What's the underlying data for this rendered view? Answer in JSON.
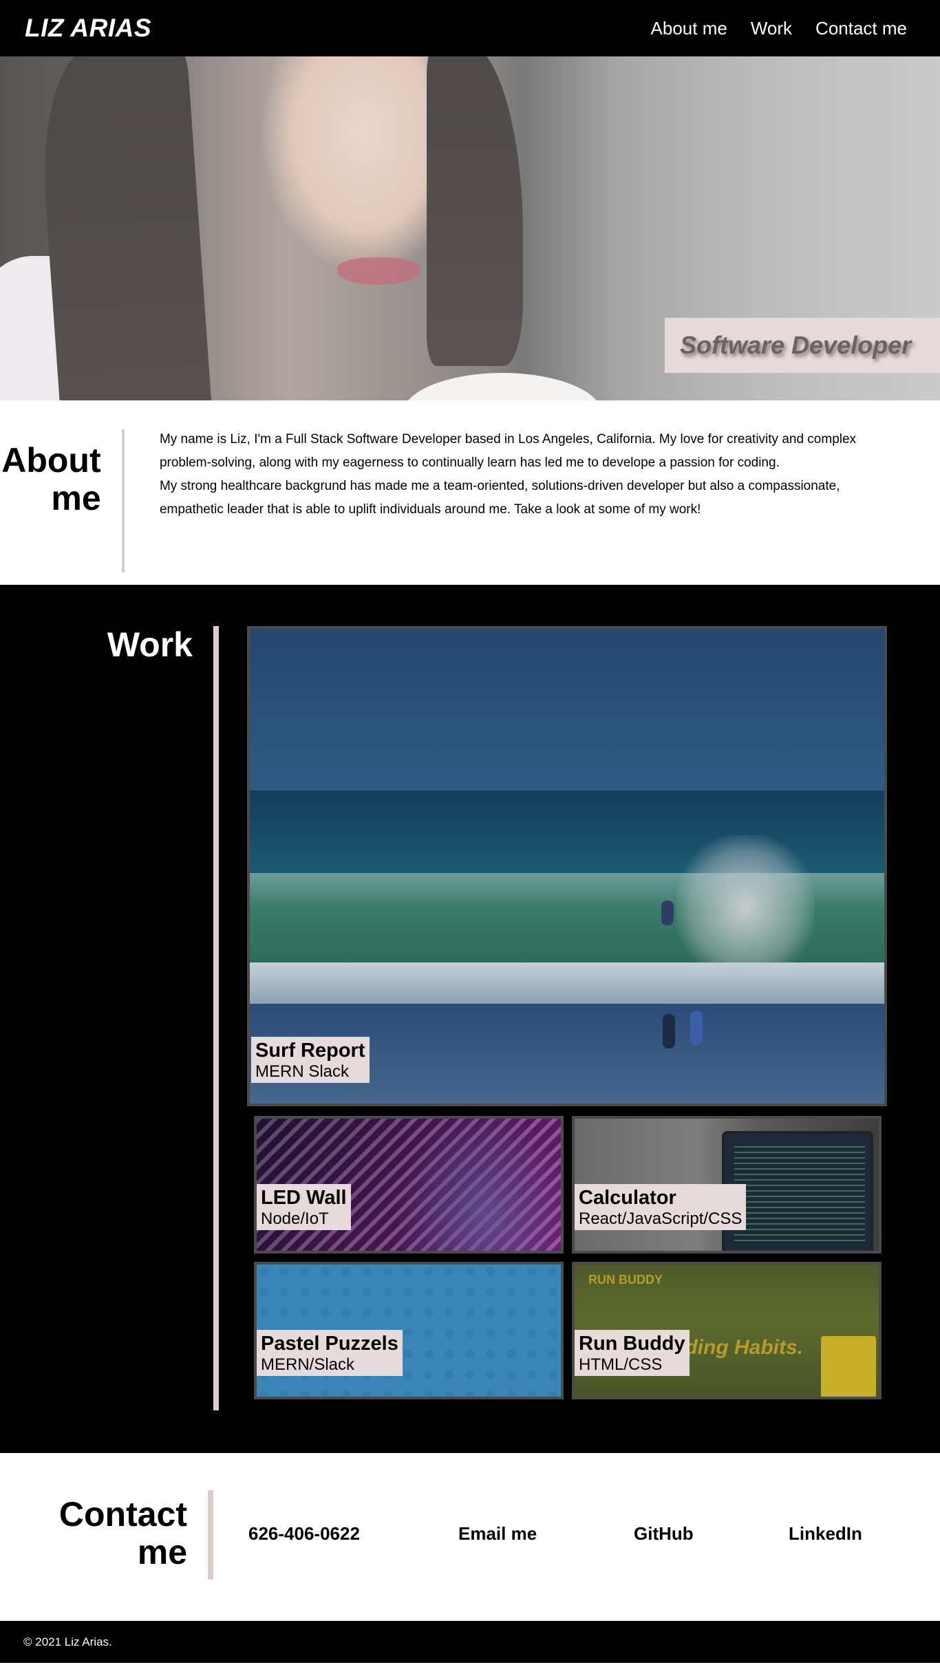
{
  "header": {
    "logo": "LIZ ARIAS",
    "nav": [
      "About me",
      "Work",
      "Contact me"
    ]
  },
  "hero": {
    "badge": "Software Developer"
  },
  "about": {
    "title": "About me",
    "paragraph1": "My name is Liz, I'm a Full Stack Software Developer based in Los Angeles, California. My love for creativity and complex problem-solving, along with my eagerness to continually learn has led me to develope a passion for coding.",
    "paragraph2": "My strong healthcare backgrund has made me a team-oriented, solutions-driven developer but also a compassionate, empathetic leader that is able to uplift individuals around me. Take a look at some of my work!"
  },
  "work": {
    "title": "Work",
    "projects": [
      {
        "title": "Surf Report",
        "tech": "MERN Slack"
      },
      {
        "title": "LED Wall",
        "tech": "Node/IoT"
      },
      {
        "title": "Calculator",
        "tech": "React/JavaScript/CSS"
      },
      {
        "title": "Pastel Puzzels",
        "tech": "MERN/Slack"
      },
      {
        "title": "Run Buddy",
        "tech": "HTML/CSS"
      }
    ],
    "run_buddy_screenshot": {
      "logo": "RUN BUDDY",
      "tagline": "art Building Habits."
    }
  },
  "contact": {
    "title": "Contact me",
    "links": [
      "626-406-0622",
      "Email me",
      "GitHub",
      "LinkedIn"
    ]
  },
  "footer": {
    "copyright": "© 2021 Liz Arias."
  },
  "colors": {
    "header_bg": "#000000",
    "accent_pink": "#e7dada",
    "divider": "#dccccc"
  }
}
